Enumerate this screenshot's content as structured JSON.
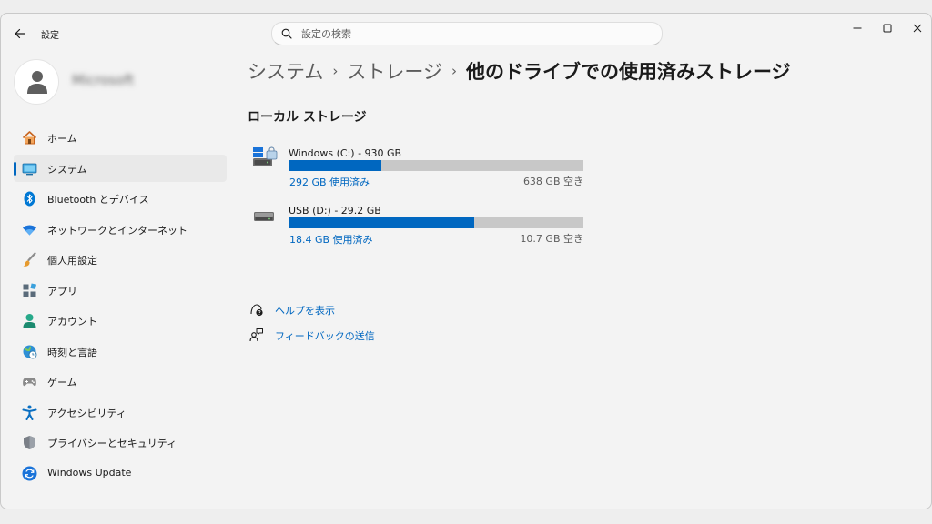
{
  "window": {
    "title": "設定",
    "search_placeholder": "設定の検索"
  },
  "profile": {
    "name": "Microsoft"
  },
  "sidebar": {
    "items": [
      {
        "label": "ホーム",
        "icon": "home-icon"
      },
      {
        "label": "システム",
        "icon": "system-icon",
        "selected": true
      },
      {
        "label": "Bluetooth とデバイス",
        "icon": "bluetooth-icon"
      },
      {
        "label": "ネットワークとインターネット",
        "icon": "wifi-icon"
      },
      {
        "label": "個人用設定",
        "icon": "brush-icon"
      },
      {
        "label": "アプリ",
        "icon": "apps-icon"
      },
      {
        "label": "アカウント",
        "icon": "account-icon"
      },
      {
        "label": "時刻と言語",
        "icon": "globe-clock-icon"
      },
      {
        "label": "ゲーム",
        "icon": "gamepad-icon"
      },
      {
        "label": "アクセシビリティ",
        "icon": "accessibility-icon"
      },
      {
        "label": "プライバシーとセキュリティ",
        "icon": "shield-icon"
      },
      {
        "label": "Windows Update",
        "icon": "update-icon"
      }
    ]
  },
  "breadcrumb": {
    "items": [
      "システム",
      "ストレージ"
    ],
    "separator": "›",
    "current": "他のドライブでの使用済みストレージ"
  },
  "section": {
    "title": "ローカル ストレージ"
  },
  "drives": [
    {
      "name": "Windows (C:) - 930 GB",
      "used": "292 GB 使用済み",
      "free": "638 GB 空き",
      "used_fraction": 0.314,
      "icon": "windows-drive-icon"
    },
    {
      "name": "USB (D:) - 29.2 GB",
      "used": "18.4 GB 使用済み",
      "free": "10.7 GB 空き",
      "used_fraction": 0.63,
      "icon": "usb-drive-icon"
    }
  ],
  "links": {
    "help": "ヘルプを表示",
    "feedback": "フィードバックの送信"
  },
  "colors": {
    "accent": "#0067c0",
    "bar_track": "#c8c8c8",
    "background": "#f3f3f3"
  }
}
